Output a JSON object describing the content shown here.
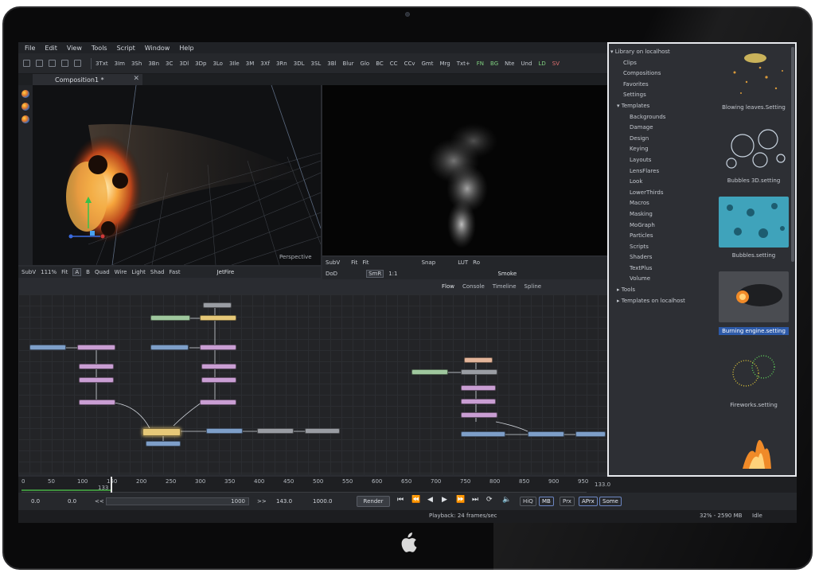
{
  "menu": [
    "File",
    "Edit",
    "View",
    "Tools",
    "Script",
    "Window",
    "Help"
  ],
  "toolbar": {
    "tools": [
      "3Txt",
      "3Im",
      "3Sh",
      "3Bn",
      "3C",
      "3Dl",
      "3Dp",
      "3Lo",
      "3Ile",
      "3M",
      "3Xf",
      "3Rn",
      "3DL",
      "3SL",
      "3Bl",
      "Blur",
      "Glo",
      "BC",
      "CC",
      "CCv",
      "Gmt",
      "Mrg",
      "Txt+",
      "FN",
      "BG",
      "Nte",
      "Und",
      "LD",
      "SV"
    ]
  },
  "document_tab": {
    "title": "Composition1 *",
    "close": "✕"
  },
  "viewer_left": {
    "label": "Perspective",
    "bar": [
      "SubV",
      "111%",
      "Fit",
      "A",
      "B",
      "Quad",
      "Wire",
      "Light",
      "Shad",
      "Fast"
    ],
    "name": "JetFire"
  },
  "viewer_right": {
    "bar_top": [
      "SubV",
      "Fit",
      "Fit",
      "Snap",
      "LUT",
      "Ro"
    ],
    "bar_bottom": [
      "DoD",
      "SmR",
      "1:1"
    ],
    "name": "Smoke"
  },
  "flow_tabs": [
    "Flow",
    "Console",
    "Timeline",
    "Spline"
  ],
  "library": {
    "tree": [
      "▾ Library on localhost",
      "Clips",
      "Compositions",
      "Favorites",
      "Settings",
      "▾ Templates",
      "Backgrounds",
      "Damage",
      "Design",
      "Keying",
      "Layouts",
      "LensFlares",
      "Look",
      "LowerThirds",
      "Macros",
      "Masking",
      "MoGraph",
      "Particles",
      "Scripts",
      "Shaders",
      "TextPlus",
      "Volume",
      "▸ Tools",
      "▸ Templates on localhost"
    ],
    "thumbnails": [
      {
        "caption": "Blowing leaves.Setting"
      },
      {
        "caption": "Bubbles 3D.setting"
      },
      {
        "caption": "Bubbles.setting"
      },
      {
        "caption": "Burning engine.setting"
      },
      {
        "caption": "Fireworks.setting"
      }
    ]
  },
  "timeline": {
    "ticks": [
      "0",
      "50",
      "100",
      "150",
      "200",
      "250",
      "300",
      "350",
      "400",
      "450",
      "500",
      "550",
      "600",
      "650",
      "700",
      "750",
      "800",
      "850",
      "900",
      "950"
    ],
    "current": "133",
    "end_label": "133.0"
  },
  "transport": {
    "start": "0.0",
    "render_start": "0.0",
    "range_end": "1000",
    "current": "143.0",
    "end": "1000.0",
    "render": "Render",
    "toggles": [
      "HiQ",
      "MB",
      "Prx",
      "APrx",
      "Some"
    ]
  },
  "status": {
    "playback": "Playback: 24 frames/sec",
    "memory": "32% - 2590 MB",
    "state": "Idle"
  }
}
